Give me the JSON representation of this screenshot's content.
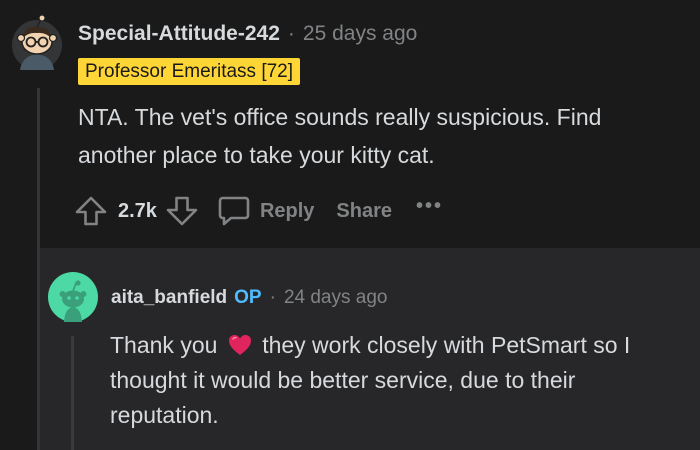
{
  "colors": {
    "background": "#1a1a1b",
    "reply_background": "#272729",
    "flair": "#ffd635",
    "op": "#4fbcff",
    "muted": "#818384",
    "text": "#d7dadc"
  },
  "comment": {
    "username": "Special-Attitude-242",
    "separator": "·",
    "timestamp": "25 days ago",
    "flair": "Professor Emeritass [72]",
    "body": "NTA. The vet's office sounds really suspicious. Find another place to take your kitty cat.",
    "votes": "2.7k",
    "reply_label": "Reply",
    "share_label": "Share",
    "more_label": "•••",
    "avatar_icon": "snoo-avatar-icon"
  },
  "reply": {
    "username": "aita_banfield",
    "op_badge": "OP",
    "separator": "·",
    "timestamp": "24 days ago",
    "body_before": "Thank you",
    "body_after": "they work closely with PetSmart so I thought it would be better service, due to their reputation.",
    "emoji_icon": "red-heart-icon",
    "avatar_icon": "default-snoo-avatar-icon"
  }
}
